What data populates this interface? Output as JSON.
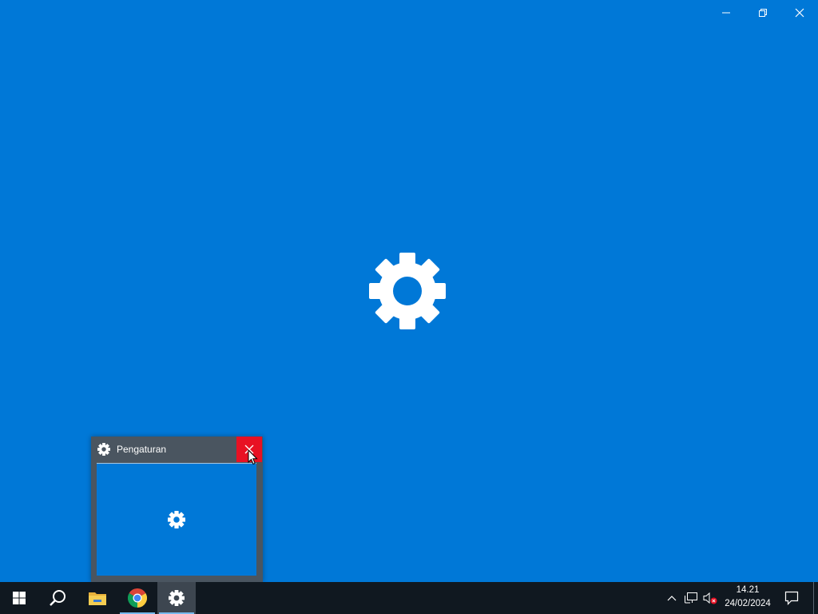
{
  "window": {
    "controls": {
      "minimize": "minimize-icon",
      "maximize": "restore-icon",
      "close": "close-icon"
    },
    "splash_icon": "gear-icon",
    "background": "#0078d7"
  },
  "preview": {
    "title": "Pengaturan",
    "icon": "gear-icon",
    "close_hover_color": "#e81123"
  },
  "taskbar": {
    "items": [
      {
        "name": "start",
        "icon": "windows-logo-icon"
      },
      {
        "name": "search",
        "icon": "search-icon"
      },
      {
        "name": "file-explorer",
        "icon": "folder-icon"
      },
      {
        "name": "chrome",
        "icon": "chrome-icon"
      },
      {
        "name": "settings",
        "icon": "gear-icon",
        "active": true
      }
    ],
    "tray": {
      "icons": [
        "chevron-up-icon",
        "network-icon",
        "volume-muted-icon",
        "notification-icon"
      ],
      "time": "14.21",
      "date": "24/02/2024"
    }
  }
}
